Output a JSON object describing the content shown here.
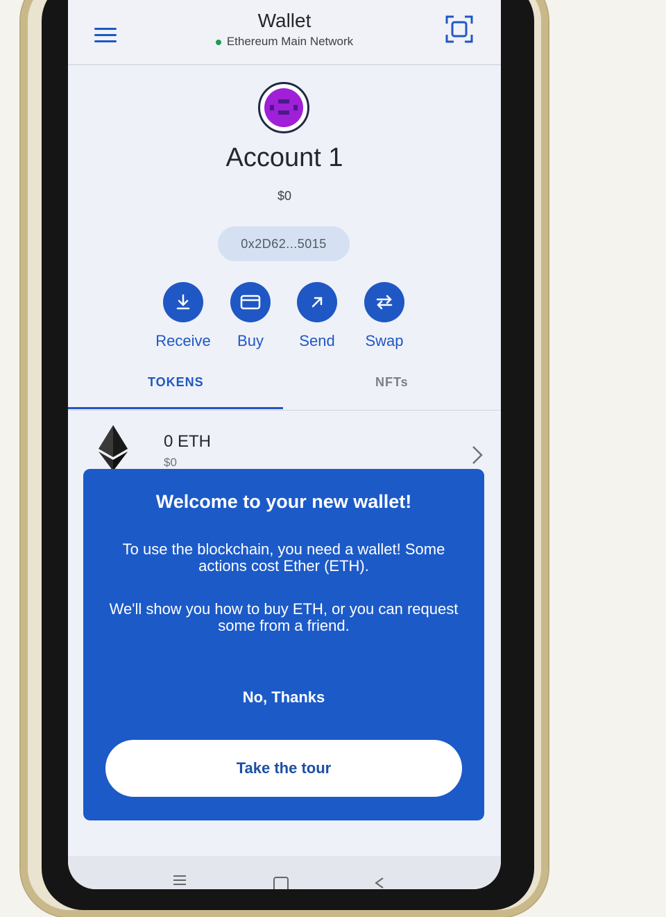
{
  "header": {
    "title": "Wallet",
    "network": "Ethereum Main Network",
    "network_status_color": "#1f9d55"
  },
  "account": {
    "name": "Account 1",
    "balance": "$0",
    "address": "0x2D62...5015"
  },
  "actions": [
    {
      "label": "Receive",
      "icon": "download-icon"
    },
    {
      "label": "Buy",
      "icon": "card-icon"
    },
    {
      "label": "Send",
      "icon": "arrow-up-right-icon"
    },
    {
      "label": "Swap",
      "icon": "swap-icon"
    }
  ],
  "tabs": [
    {
      "label": "TOKENS",
      "active": true
    },
    {
      "label": "NFTs",
      "active": false
    }
  ],
  "tokens": [
    {
      "amount": "0 ETH",
      "fiat": "$0",
      "icon": "ethereum-icon"
    }
  ],
  "modal": {
    "title": "Welcome to your new wallet!",
    "paragraph1": "To use the blockchain, you need a wallet! Some actions cost Ether (ETH).",
    "paragraph2": "We'll show you how to buy ETH, or you can request some from a friend.",
    "dismiss_label": "No, Thanks",
    "cta_label": "Take the tour"
  },
  "colors": {
    "accent": "#1f57c4",
    "modal_bg": "#1c5ac8"
  }
}
